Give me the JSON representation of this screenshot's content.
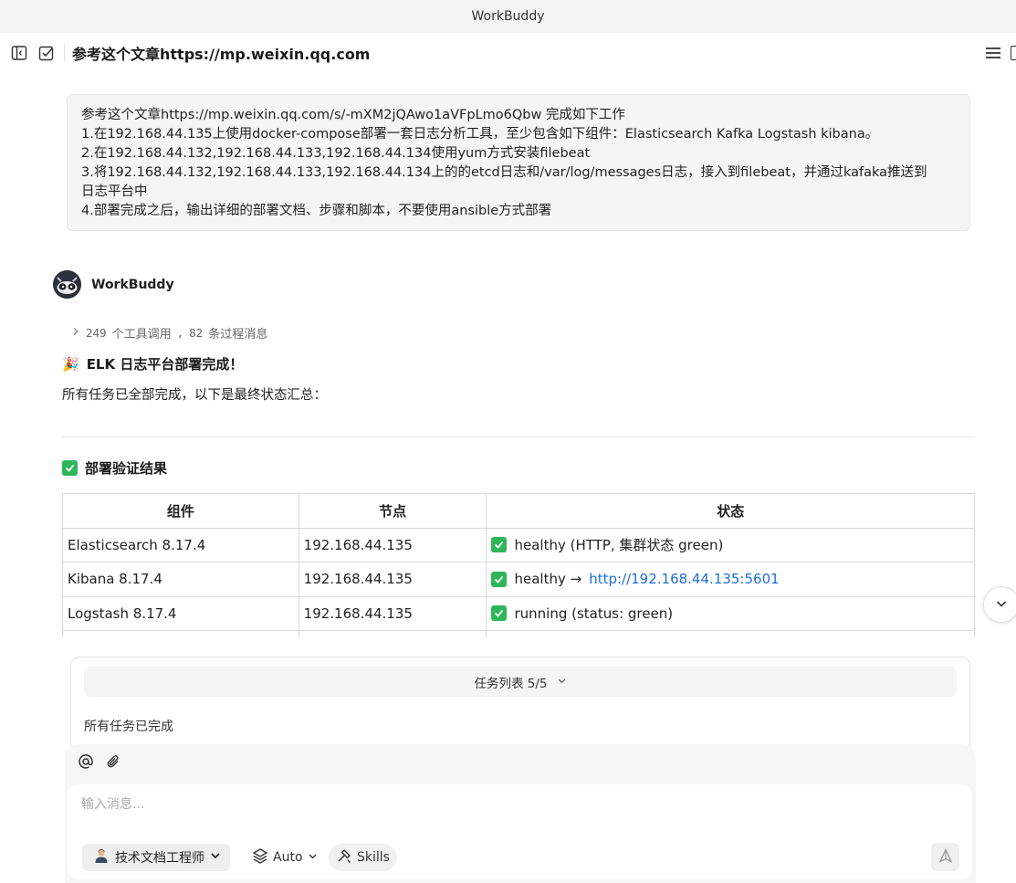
{
  "window": {
    "title": "WorkBuddy"
  },
  "header": {
    "title": "参考这个文章https://mp.weixin.qq.com"
  },
  "user_message": {
    "lines": [
      "参考这个文章https://mp.weixin.qq.com/s/-mXM2jQAwo1aVFpLmo6Qbw 完成如下工作",
      "1.在192.168.44.135上使用docker-compose部署一套日志分析工具，至少包含如下组件：Elasticsearch Kafka Logstash  kibana。",
      "2.在192.168.44.132,192.168.44.133,192.168.44.134使用yum方式安装filebeat",
      "3.将192.168.44.132,192.168.44.133,192.168.44.134上的的etcd日志和/var/log/messages日志，接入到filebeat，并通过kafaka推送到",
      "日志平台中",
      "4.部署完成之后，输出详细的部署文档、步骤和脚本，不要使用ansible方式部署"
    ]
  },
  "assistant": {
    "name": "WorkBuddy",
    "tool_calls_count": "249",
    "tool_calls_label": "个工具调用",
    "separator": ",",
    "process_count": "82",
    "process_label": "条过程消息",
    "result_emoji": "🎉",
    "result_title": "ELK 日志平台部署完成！",
    "result_subtitle": "所有任务已全部完成，以下是最终状态汇总：",
    "verify_title": "部署验证结果"
  },
  "table": {
    "headers": [
      "组件",
      "节点",
      "状态"
    ],
    "rows": [
      {
        "component": "Elasticsearch 8.17.4",
        "node": "192.168.44.135",
        "status": "healthy (HTTP, 集群状态 green)",
        "link": ""
      },
      {
        "component": "Kibana 8.17.4",
        "node": "192.168.44.135",
        "status": "healthy →",
        "link": "http://192.168.44.135:5601"
      },
      {
        "component": "Logstash 8.17.4",
        "node": "192.168.44.135",
        "status": "running (status: green)",
        "link": ""
      }
    ]
  },
  "task_panel": {
    "title": "任务列表",
    "progress": "5/5",
    "done_text": "所有任务已完成"
  },
  "composer": {
    "placeholder": "输入消息...",
    "persona_label": "技术文档工程师",
    "model_label": "Auto",
    "skills_label": "Skills"
  },
  "colors": {
    "check_green": "#2fb55a",
    "link_blue": "#1e6fd9"
  },
  "icons": [
    "sidebar-toggle-icon",
    "new-task-icon",
    "menu-icon",
    "chevron-right-icon",
    "checkmark-icon",
    "chevron-down-icon",
    "at-icon",
    "paperclip-icon",
    "layers-icon",
    "skills-icon",
    "send-icon"
  ]
}
